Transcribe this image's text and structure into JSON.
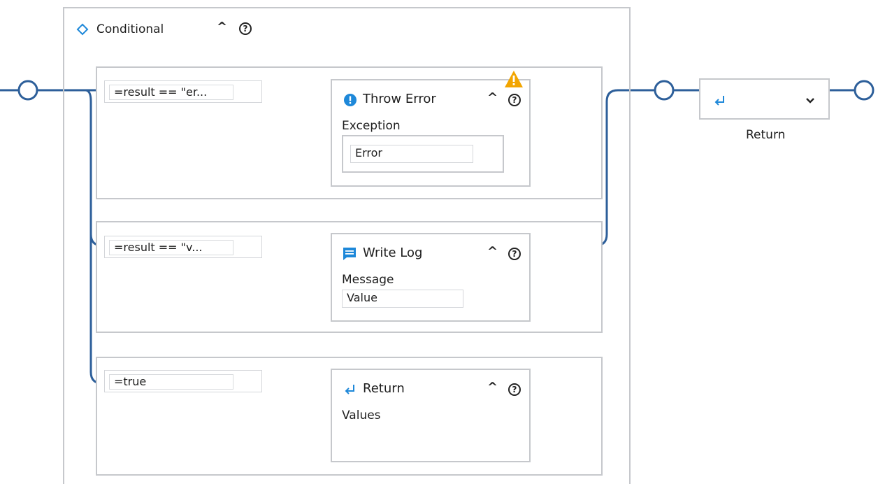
{
  "conditional": {
    "title": "Conditional",
    "icon": "diamond-icon",
    "collapse_icon": "chevron-up-icon",
    "help_icon": "help-circle-icon",
    "branches": [
      {
        "condition": "=result == \"er...",
        "activity": {
          "title": "Throw Error",
          "icon": "error-info-icon",
          "warning_icon": "warning-triangle-icon",
          "field_label": "Exception",
          "field_value": "Error"
        }
      },
      {
        "condition": "=result == \"v...",
        "activity": {
          "title": "Write Log",
          "icon": "message-icon",
          "field_label": "Message",
          "field_value": "Value"
        }
      },
      {
        "condition": "=true",
        "activity": {
          "title": "Return",
          "icon": "return-arrow-icon",
          "field_label": "Values"
        }
      }
    ]
  },
  "return_node": {
    "label": "Return",
    "icon": "return-arrow-icon",
    "dropdown_icon": "chevron-down-icon"
  },
  "colors": {
    "wire": "#2d5f9a",
    "border": "#c6c8cc",
    "accent_blue": "#1e88d9",
    "warning": "#f2a500"
  }
}
